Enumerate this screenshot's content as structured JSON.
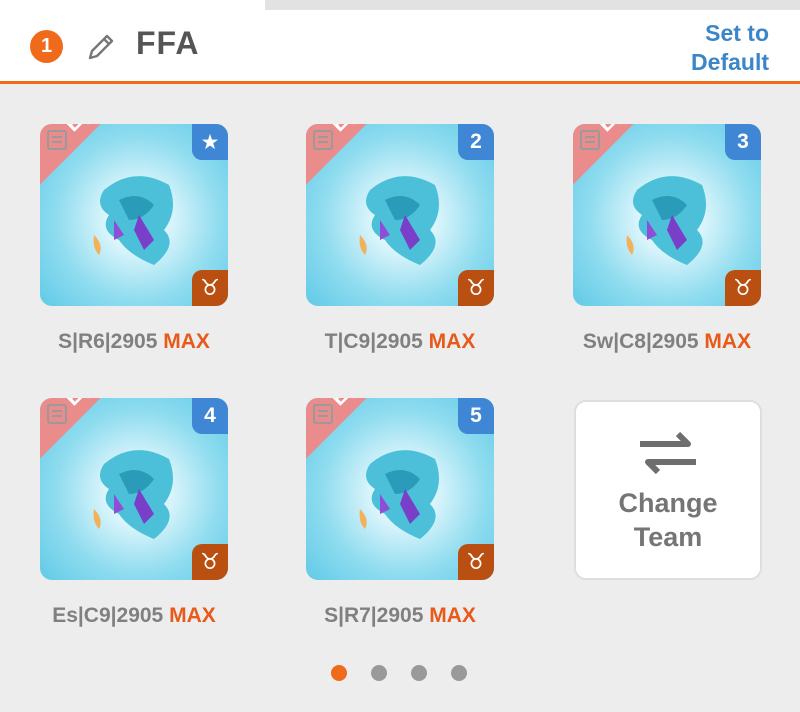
{
  "header": {
    "team_number": "1",
    "team_name": "FFA",
    "set_default_line1": "Set to",
    "set_default_line2": "Default",
    "icons": [
      "pencil-icon"
    ]
  },
  "cards": [
    {
      "rarity": "Epic",
      "slot": "★",
      "label": "S|R6|2905",
      "max": "MAX",
      "element_icon": "taurus-icon"
    },
    {
      "rarity": "Epic",
      "slot": "2",
      "label": "T|C9|2905",
      "max": "MAX",
      "element_icon": "taurus-icon"
    },
    {
      "rarity": "Epic",
      "slot": "3",
      "label": "Sw|C8|2905",
      "max": "MAX",
      "element_icon": "taurus-icon"
    },
    {
      "rarity": "Epic",
      "slot": "4",
      "label": "Es|C9|2905",
      "max": "MAX",
      "element_icon": "taurus-icon"
    },
    {
      "rarity": "Epic",
      "slot": "5",
      "label": "S|R7|2905",
      "max": "MAX",
      "element_icon": "taurus-icon"
    }
  ],
  "change_team": {
    "line1": "Change",
    "line2": "Team",
    "icon": "swap-arrows-icon"
  },
  "pager": {
    "total": 4,
    "current": 1
  },
  "colors": {
    "accent": "#f06a1c",
    "link": "#3a86c8",
    "epic_ribbon": "#eb8c8c",
    "slot_badge": "#3f86d4",
    "element_badge": "#b95012"
  },
  "element_glyph": "♉"
}
